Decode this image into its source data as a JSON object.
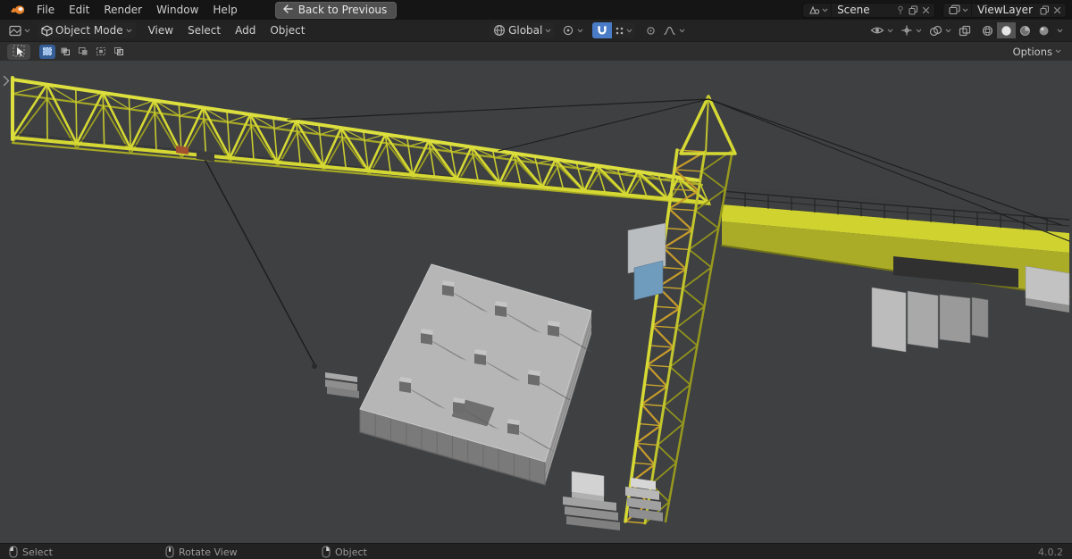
{
  "topbar": {
    "menus": [
      "File",
      "Edit",
      "Render",
      "Window",
      "Help"
    ],
    "back_button_label": "Back to Previous",
    "scene_selector": {
      "label": "Scene"
    },
    "view_layer_selector": {
      "label": "ViewLayer"
    }
  },
  "viewport_header": {
    "mode_label": "Object Mode",
    "menus": [
      "View",
      "Select",
      "Add",
      "Object"
    ],
    "orientation_label": "Global"
  },
  "tool_bar": {
    "options_label": "Options"
  },
  "status_bar": {
    "hints": [
      "Select",
      "Rotate View",
      "Object"
    ],
    "version": "4.0.2"
  },
  "colors": {
    "viewport_bg": "#3e4042",
    "crane_yellow": "#d5d832",
    "crane_yellow_bright": "#dcdf3e",
    "crane_yellow_dark": "#9b9d21",
    "brace_orange": "#c79b2b",
    "counter_jib_top": "#d0d32f",
    "counter_jib_side": "#aaac27",
    "concrete_top": "#b6b6b6",
    "concrete_side": "#9c9c9c",
    "concrete_shade": "#7a7a7a",
    "cable": "#1e1e1e",
    "snap_active": "#4a7cc7"
  }
}
